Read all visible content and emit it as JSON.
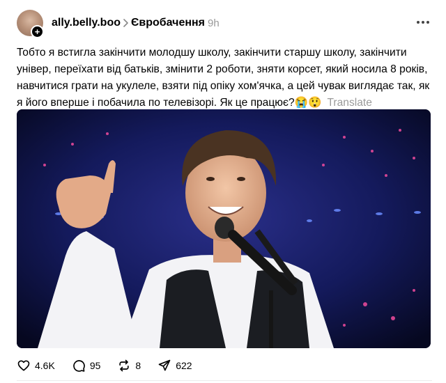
{
  "post": {
    "username": "ally.belly.boo",
    "topic": "Євробачення",
    "time": "9h",
    "text": "Тобто я встигла закінчити молодшу школу, закінчити старшу школу, закінчити універ, переїхати від батьків, змінити 2 роботи, зняти корсет, який носила 8 років, навчитися грати на укулеле, взяти під опіку хом'ячка, а цей чувак виглядає так, як я його вперше і побачила по телевізорі. Як це працює?",
    "emojis": "😭😲",
    "translate_label": "Translate"
  },
  "icons": {
    "avatar_badge": "plus-icon",
    "topic_separator": "chevron-right-icon",
    "menu": "more-horizontal-icon",
    "like": "heart-icon",
    "comment": "comment-bubble-icon",
    "repost": "repost-icon",
    "share": "send-icon"
  },
  "actions": {
    "likes": "4.6K",
    "comments": "95",
    "reposts": "8",
    "shares": "622"
  }
}
